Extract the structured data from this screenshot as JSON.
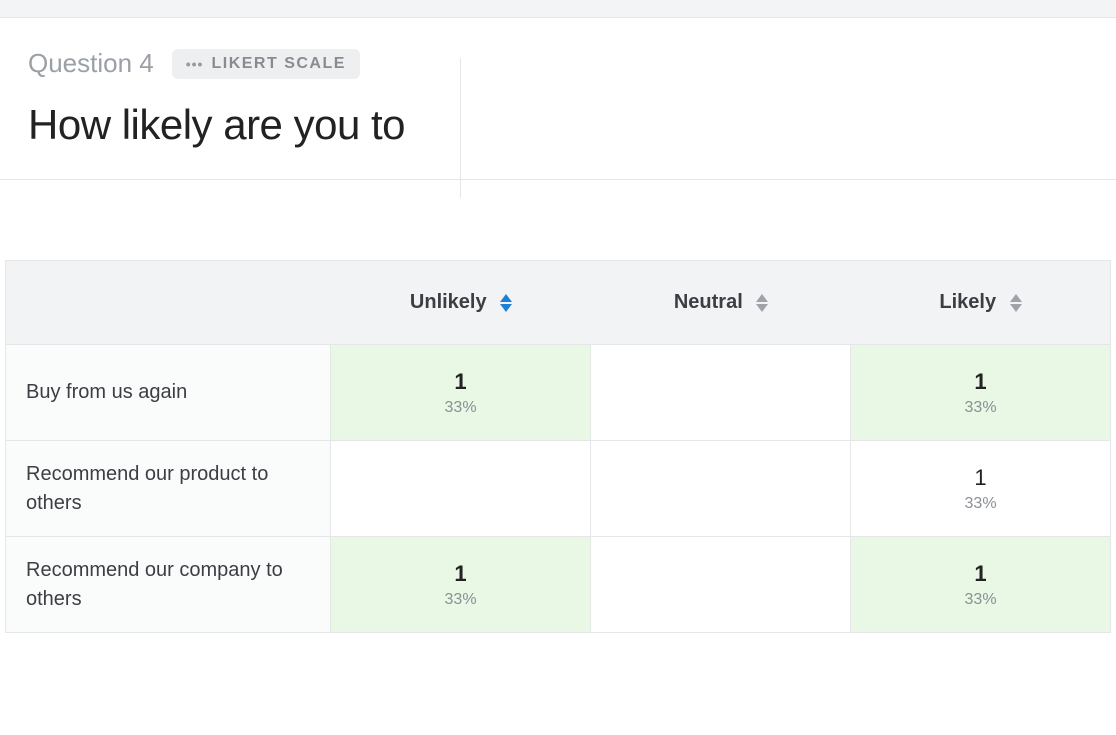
{
  "header": {
    "question_number": "Question 4",
    "badge_dots": "•••",
    "badge_label": "LIKERT SCALE",
    "question_text": "How likely are you to"
  },
  "columns": [
    {
      "label": "Unlikely",
      "sorted": true
    },
    {
      "label": "Neutral",
      "sorted": false
    },
    {
      "label": "Likely",
      "sorted": false
    }
  ],
  "rows": [
    {
      "label": "Buy from us again",
      "cells": [
        {
          "count": "1",
          "pct": "33%",
          "style": "max"
        },
        {
          "count": "",
          "pct": "",
          "style": "empty"
        },
        {
          "count": "1",
          "pct": "33%",
          "style": "max"
        }
      ]
    },
    {
      "label": "Recommend our product to others",
      "cells": [
        {
          "count": "",
          "pct": "",
          "style": "empty"
        },
        {
          "count": "",
          "pct": "",
          "style": "empty"
        },
        {
          "count": "1",
          "pct": "33%",
          "style": "plain"
        }
      ]
    },
    {
      "label": "Recommend our company to others",
      "cells": [
        {
          "count": "1",
          "pct": "33%",
          "style": "max"
        },
        {
          "count": "",
          "pct": "",
          "style": "empty"
        },
        {
          "count": "1",
          "pct": "33%",
          "style": "max"
        }
      ]
    }
  ]
}
